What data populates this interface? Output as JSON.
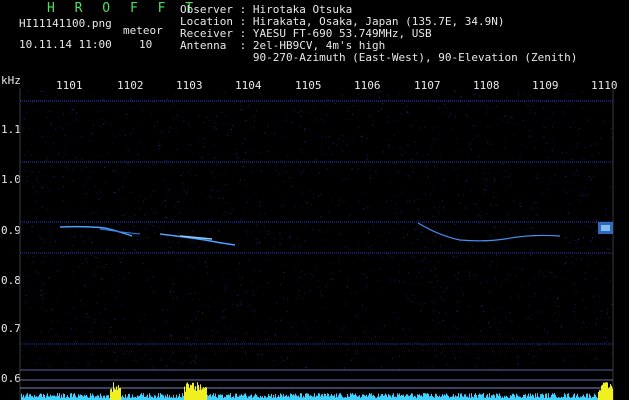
{
  "header": {
    "logo": "H R O F F T",
    "filename": "HI11141100.png",
    "datetime": "10.11.14 11:00",
    "meteor_label": "meteor",
    "meteor_count": "10",
    "info_lines": [
      "Observer : Hirotaka Otsuka",
      "Location : Hirakata, Osaka, Japan (135.7E, 34.9N)",
      "Receiver : YAESU FT-690 53.749MHz, USB",
      "Antenna  : 2el-HB9CV, 4m's high",
      "           90-270-Azimuth (East-West), 90-Elevation (Zenith)"
    ]
  },
  "axes": {
    "y_unit": "kHz",
    "y_ticks": [
      "1.1",
      "1.0",
      "0.9",
      "0.8",
      "0.7",
      "0.6"
    ],
    "x_ticks": [
      "1101",
      "1102",
      "1103",
      "1104",
      "1105",
      "1106",
      "1107",
      "1108",
      "1109",
      "1110"
    ]
  },
  "colors": {
    "background": "#000000",
    "grid_dots": "#2a38c8",
    "signal": "#4aa0ff",
    "text": "#e8e8e8",
    "accent_green": "#39d84a",
    "level_bars": "#3fd0ff",
    "level_peaks": "#f0f020"
  }
}
